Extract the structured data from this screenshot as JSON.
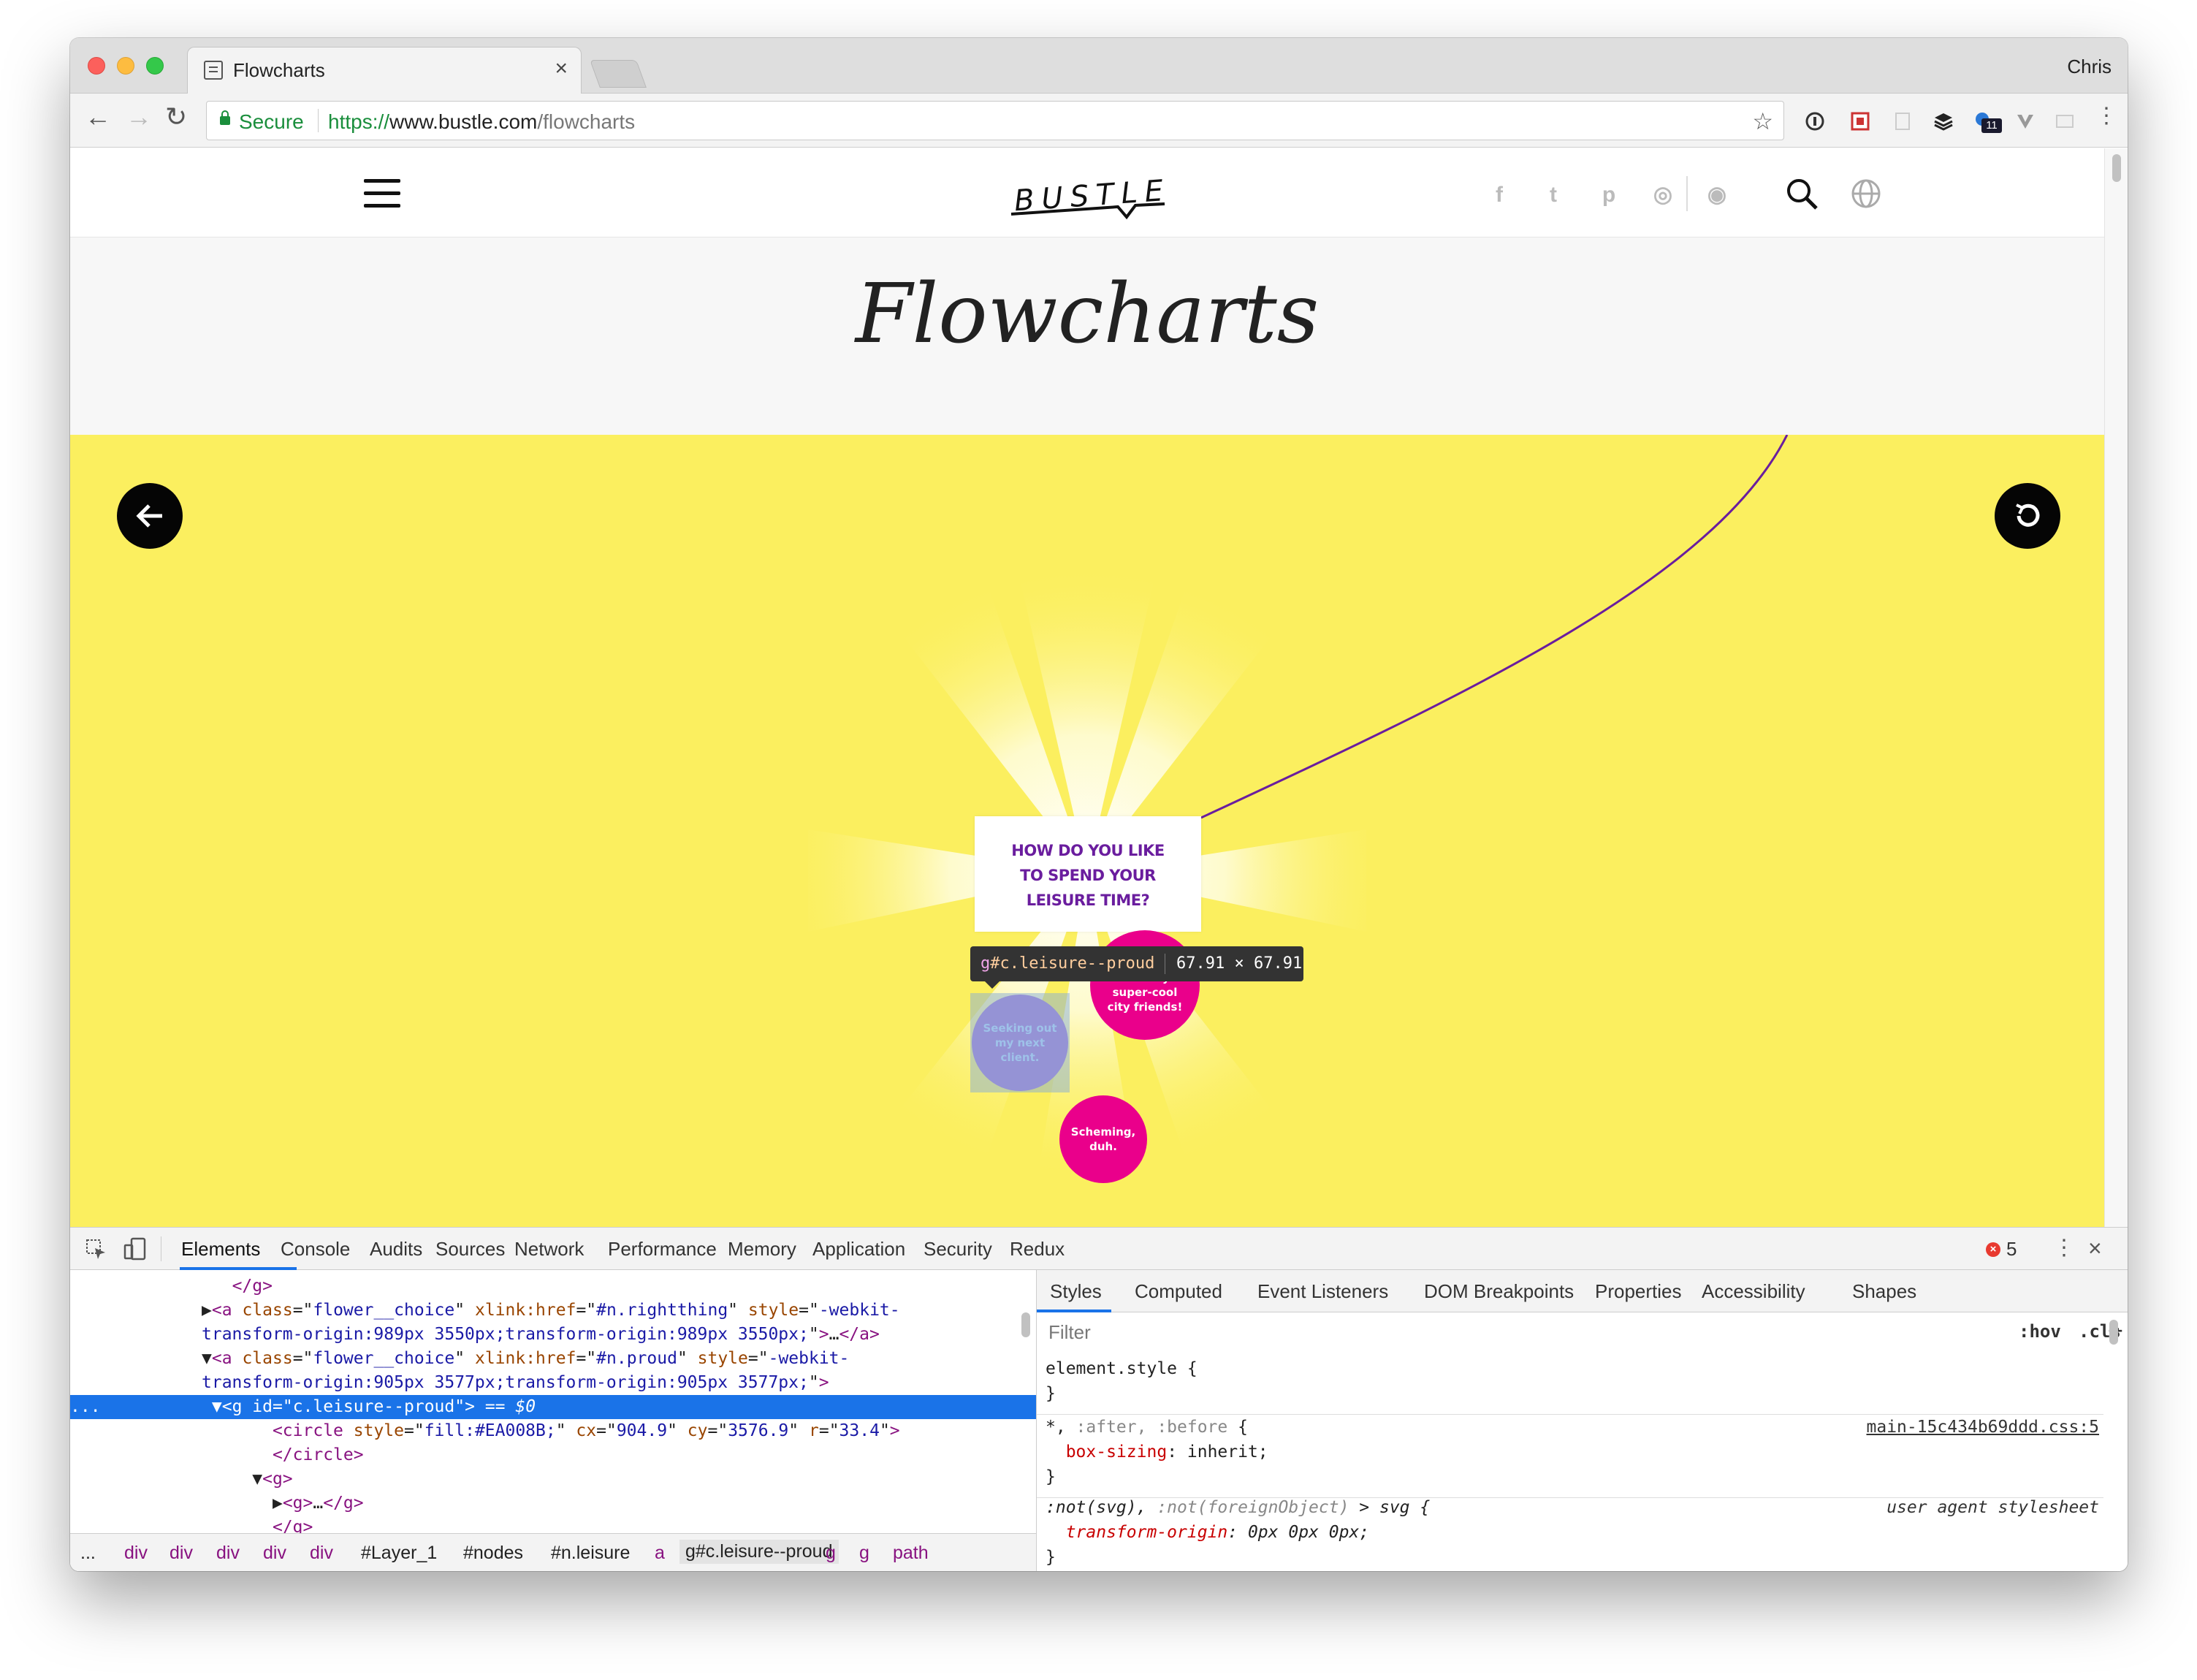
{
  "browser": {
    "tab_title": "Flowcharts",
    "tab_close": "×",
    "profile": "Chris",
    "secure_label": "Secure",
    "url_scheme": "https://",
    "url_host": "www.bustle.com",
    "url_path": "/flowcharts",
    "ext_badge": "11"
  },
  "site": {
    "logo_text": "BUSTLE",
    "social_icons": [
      "facebook-icon",
      "twitter-icon",
      "pinterest-icon",
      "instagram-icon",
      "podcast-icon"
    ],
    "social_glyphs": [
      "f",
      "t",
      "p",
      "◎",
      "◉"
    ],
    "page_title": "Flowcharts"
  },
  "flowchart": {
    "question": "HOW DO YOU LIKE\nTO SPEND YOUR\nLEISURE TIME?",
    "choices": [
      {
        "label": "Seeking out\nmy next\nclient.",
        "color": "#a77fcf"
      },
      {
        "label": "Hanging out\nwith my\nsuper-cool\ncity friends!",
        "color": "#EA008B"
      },
      {
        "label": "Scheming,\nduh.",
        "color": "#EA008B"
      }
    ],
    "background_color": "#fbef5f",
    "line_color": "#6a1d9e"
  },
  "inspector_tooltip": {
    "tag": "g",
    "selector": "#c.leisure--proud",
    "size": "67.91 × 67.91"
  },
  "devtools": {
    "tabs": [
      "Elements",
      "Console",
      "Audits",
      "Sources",
      "Network",
      "Performance",
      "Memory",
      "Application",
      "Security",
      "Redux"
    ],
    "active_tab": "Elements",
    "error_count": "5",
    "dom_lines": [
      {
        "indent": 16,
        "html": "<span class=\"tg\">&lt;/g&gt;</span>"
      },
      {
        "indent": 13,
        "html": "▶<span class=\"tg\">&lt;a</span> <span class=\"at\">class</span>=\"<span class=\"av\">flower__choice</span>\" <span class=\"at\">xlink:href</span>=\"<span class=\"av\">#n.rightthing</span>\" <span class=\"at\">style</span>=\"<span class=\"av\">-webkit-</span>"
      },
      {
        "indent": 13,
        "html": "<span class=\"av\">transform-origin:989px 3550px;transform-origin:989px 3550px;</span>\"<span class=\"tg\">&gt;</span>…<span class=\"tg\">&lt;/a&gt;</span>"
      },
      {
        "indent": 13,
        "html": "▼<span class=\"tg\">&lt;a</span> <span class=\"at\">class</span>=\"<span class=\"av\">flower__choice</span>\" <span class=\"at\">xlink:href</span>=\"<span class=\"av\">#n.proud</span>\" <span class=\"at\">style</span>=\"<span class=\"av\">-webkit-</span>"
      },
      {
        "indent": 13,
        "html": "<span class=\"av\">transform-origin:905px 3577px;transform-origin:905px 3577px;</span>\"<span class=\"tg\">&gt;</span>"
      },
      {
        "indent": 0,
        "html": "<span style=\"color:#fff\">...</span>           ▼<span class=\"tg\">&lt;g</span> <span class=\"at\">id</span>=\"<span class=\"av\">c.leisure--proud</span>\"<span class=\"tg\">&gt;</span> == <i>$0</i>",
        "selected": true
      },
      {
        "indent": 20,
        "html": "<span class=\"tg\">&lt;circle</span> <span class=\"at\">style</span>=\"<span class=\"av\">fill:#EA008B;</span>\" <span class=\"at\">cx</span>=\"<span class=\"av\">904.9</span>\" <span class=\"at\">cy</span>=\"<span class=\"av\">3576.9</span>\" <span class=\"at\">r</span>=\"<span class=\"av\">33.4</span>\"<span class=\"tg\">&gt;</span>"
      },
      {
        "indent": 20,
        "html": "<span class=\"tg\">&lt;/circle&gt;</span>"
      },
      {
        "indent": 18,
        "html": "▼<span class=\"tg\">&lt;g&gt;</span>"
      },
      {
        "indent": 20,
        "html": "▶<span class=\"tg\">&lt;g&gt;</span>…<span class=\"tg\">&lt;/g&gt;</span>"
      },
      {
        "indent": 20,
        "html": "<span class=\"tg\">&lt;/g&gt;</span>"
      }
    ],
    "breadcrumbs": [
      "...",
      "div",
      "div",
      "div",
      "div",
      "div",
      "#Layer_1",
      "#nodes",
      "#n.leisure",
      "a",
      "g#c.leisure--proud",
      "g",
      "g",
      "path"
    ],
    "styles_tabs": [
      "Styles",
      "Computed",
      "Event Listeners",
      "DOM Breakpoints",
      "Properties",
      "Accessibility",
      "Shapes"
    ],
    "filter_placeholder": "Filter",
    "hov": ":hov",
    "cls": ".cls",
    "rules": [
      {
        "lines": [
          "element.style {",
          "}"
        ],
        "source": ""
      },
      {
        "lines": [
          "*, <span class=\"pseudo\">:after, :before</span> {",
          "  <span class=\"prop\">box-sizing</span>: inherit;",
          "}"
        ],
        "source": "main-15c434b69ddd.css:5"
      },
      {
        "lines": [
          ":not(svg), <span class=\"pseudo\">:not(foreignObject)</span> &gt; svg {",
          "  <span class=\"prop\">transform-origin</span>: 0px 0px 0px;",
          "}"
        ],
        "source": "user agent stylesheet",
        "ua": true,
        "italic": true
      }
    ]
  }
}
